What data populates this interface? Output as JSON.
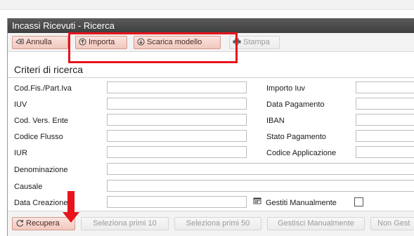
{
  "window": {
    "title": "Incassi Ricevuti - Ricerca"
  },
  "toolbar": {
    "annulla": {
      "label": "Annulla",
      "icon": "cancel-icon"
    },
    "importa": {
      "label": "Importa",
      "icon": "import-circle-icon"
    },
    "scarica": {
      "label": "Scarica modello",
      "icon": "download-circle-icon"
    },
    "stampa": {
      "label": "Stampa",
      "icon": "printer-icon"
    }
  },
  "section": {
    "title": "Criteri di ricerca"
  },
  "fields": {
    "codfis": {
      "label": "Cod.Fis./Part.Iva",
      "value": ""
    },
    "iuv": {
      "label": "IUV",
      "value": ""
    },
    "codvers": {
      "label": "Cod. Vers. Ente",
      "value": ""
    },
    "codflusso": {
      "label": "Codice Flusso",
      "value": ""
    },
    "iur": {
      "label": "IUR",
      "value": ""
    },
    "denominazione": {
      "label": "Denominazione",
      "value": ""
    },
    "causale": {
      "label": "Causale",
      "value": ""
    },
    "datacreazione": {
      "label": "Data Creazione",
      "value": ""
    },
    "importoiuv": {
      "label": "Importo Iuv",
      "value": ""
    },
    "datapagamento": {
      "label": "Data Pagamento",
      "value": ""
    },
    "iban": {
      "label": "IBAN",
      "value": ""
    },
    "statopagamento": {
      "label": "Stato Pagamento",
      "value": ""
    },
    "codiceapplicazione": {
      "label": "Codice Applicazione",
      "value": ""
    },
    "gestiti": {
      "label": "Gestiti Manualmente",
      "checked": false
    }
  },
  "bottom": {
    "recupera": {
      "label": "Recupera",
      "icon": "refresh-icon"
    },
    "primi10": "Seleziona primi 10",
    "primi50": "Seleziona primi 50",
    "gestisci": "Gestisci Manualmente",
    "nongest": "Non Gest"
  },
  "colors": {
    "highlight": "#e8131b",
    "titlebar": "#4a4a4a",
    "red_button": "#f1c7bd"
  }
}
